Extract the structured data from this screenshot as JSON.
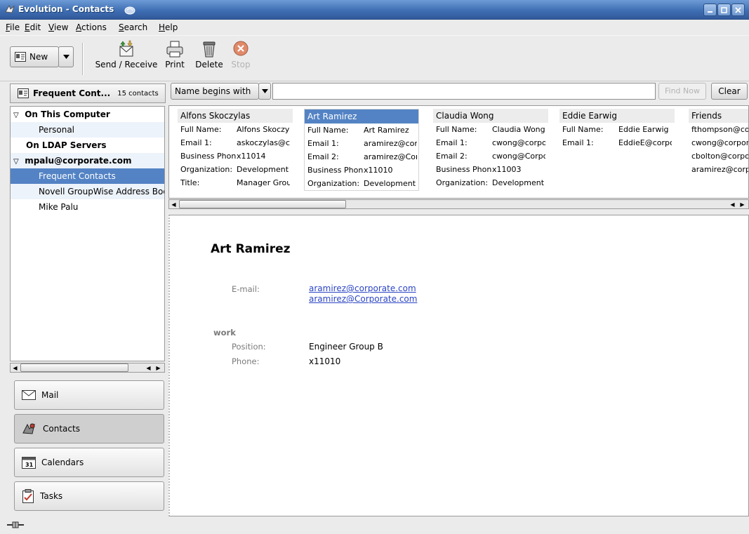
{
  "window": {
    "title": "Evolution - Contacts"
  },
  "menu": {
    "file": {
      "pre": "",
      "key": "F",
      "post": "ile"
    },
    "edit": {
      "pre": "",
      "key": "E",
      "post": "dit"
    },
    "view": {
      "pre": "",
      "key": "V",
      "post": "iew"
    },
    "actions": {
      "pre": "",
      "key": "A",
      "post": "ctions"
    },
    "search": {
      "pre": "",
      "key": "S",
      "post": "earch"
    },
    "help": {
      "pre": "",
      "key": "H",
      "post": "elp"
    }
  },
  "toolbar": {
    "new_label": "New",
    "send_receive_label": "Send / Receive",
    "print_label": "Print",
    "delete_label": "Delete",
    "stop_label": "Stop"
  },
  "left_panel": {
    "header_title": "Frequent Cont...",
    "header_count": "15 contacts",
    "tree": [
      {
        "label": "On This Computer",
        "bold": true,
        "expander": "▽"
      },
      {
        "label": "Personal",
        "bold": false,
        "expander": ""
      },
      {
        "label": "On LDAP Servers",
        "bold": true,
        "expander": ""
      },
      {
        "label": "mpalu@corporate.com",
        "bold": true,
        "expander": "▽"
      },
      {
        "label": "Frequent Contacts",
        "bold": false,
        "expander": ""
      },
      {
        "label": "Novell GroupWise Address Book",
        "bold": false,
        "expander": ""
      },
      {
        "label": "Mike Palu",
        "bold": false,
        "expander": ""
      }
    ]
  },
  "switcher": {
    "mail": "Mail",
    "contacts": "Contacts",
    "calendars": "Calendars",
    "tasks": "Tasks"
  },
  "search": {
    "mode": "Name begins with",
    "query": "",
    "find_now_label": "Find Now",
    "clear_label": "Clear"
  },
  "cards": [
    {
      "name": "Alfons Skoczylas",
      "fields": [
        {
          "label": "Full Name:",
          "value": "Alfons Skoczylas"
        },
        {
          "label": "Email 1:",
          "value": "askoczylas@corporate.com"
        },
        {
          "label": "Business Phone:",
          "value": "x11014"
        },
        {
          "label": "Organization:",
          "value": "Development"
        },
        {
          "label": "Title:",
          "value": "Manager Group"
        }
      ]
    },
    {
      "name": "Art Ramirez",
      "fields": [
        {
          "label": "Full Name:",
          "value": "Art Ramirez"
        },
        {
          "label": "Email 1:",
          "value": "aramirez@corporate.com"
        },
        {
          "label": "Email 2:",
          "value": "aramirez@Corporate.com"
        },
        {
          "label": "Business Phone:",
          "value": "x11010"
        },
        {
          "label": "Organization:",
          "value": "Development"
        }
      ]
    },
    {
      "name": "Claudia Wong",
      "fields": [
        {
          "label": "Full Name:",
          "value": "Claudia Wong"
        },
        {
          "label": "Email 1:",
          "value": "cwong@corporate.com"
        },
        {
          "label": "Email 2:",
          "value": "cwong@Corporate.com"
        },
        {
          "label": "Business Phone:",
          "value": "x11003"
        },
        {
          "label": "Organization:",
          "value": "Development"
        }
      ]
    },
    {
      "name": "Eddie Earwig",
      "fields": [
        {
          "label": "Full Name:",
          "value": "Eddie Earwig"
        },
        {
          "label": "Email 1:",
          "value": "EddieE@corporate.com"
        }
      ]
    },
    {
      "name": "Friends",
      "fields": [
        {
          "label": "",
          "value": "fthompson@corporate.com"
        },
        {
          "label": "",
          "value": "cwong@corporate.com"
        },
        {
          "label": "",
          "value": "cbolton@corporate.com"
        },
        {
          "label": "",
          "value": "aramirez@corporate.com"
        }
      ]
    }
  ],
  "preview": {
    "name": "Art Ramirez",
    "email_label": "E-mail:",
    "emails": [
      "aramirez@corporate.com",
      "aramirez@Corporate.com"
    ],
    "work_section": "work",
    "position_label": "Position:",
    "position_value": "Engineer Group B",
    "phone_label": "Phone:",
    "phone_value": "x11010"
  },
  "colors": {
    "selection": "#5383c4",
    "link": "#2b45c4",
    "titlebar": "#3f6fb4"
  }
}
